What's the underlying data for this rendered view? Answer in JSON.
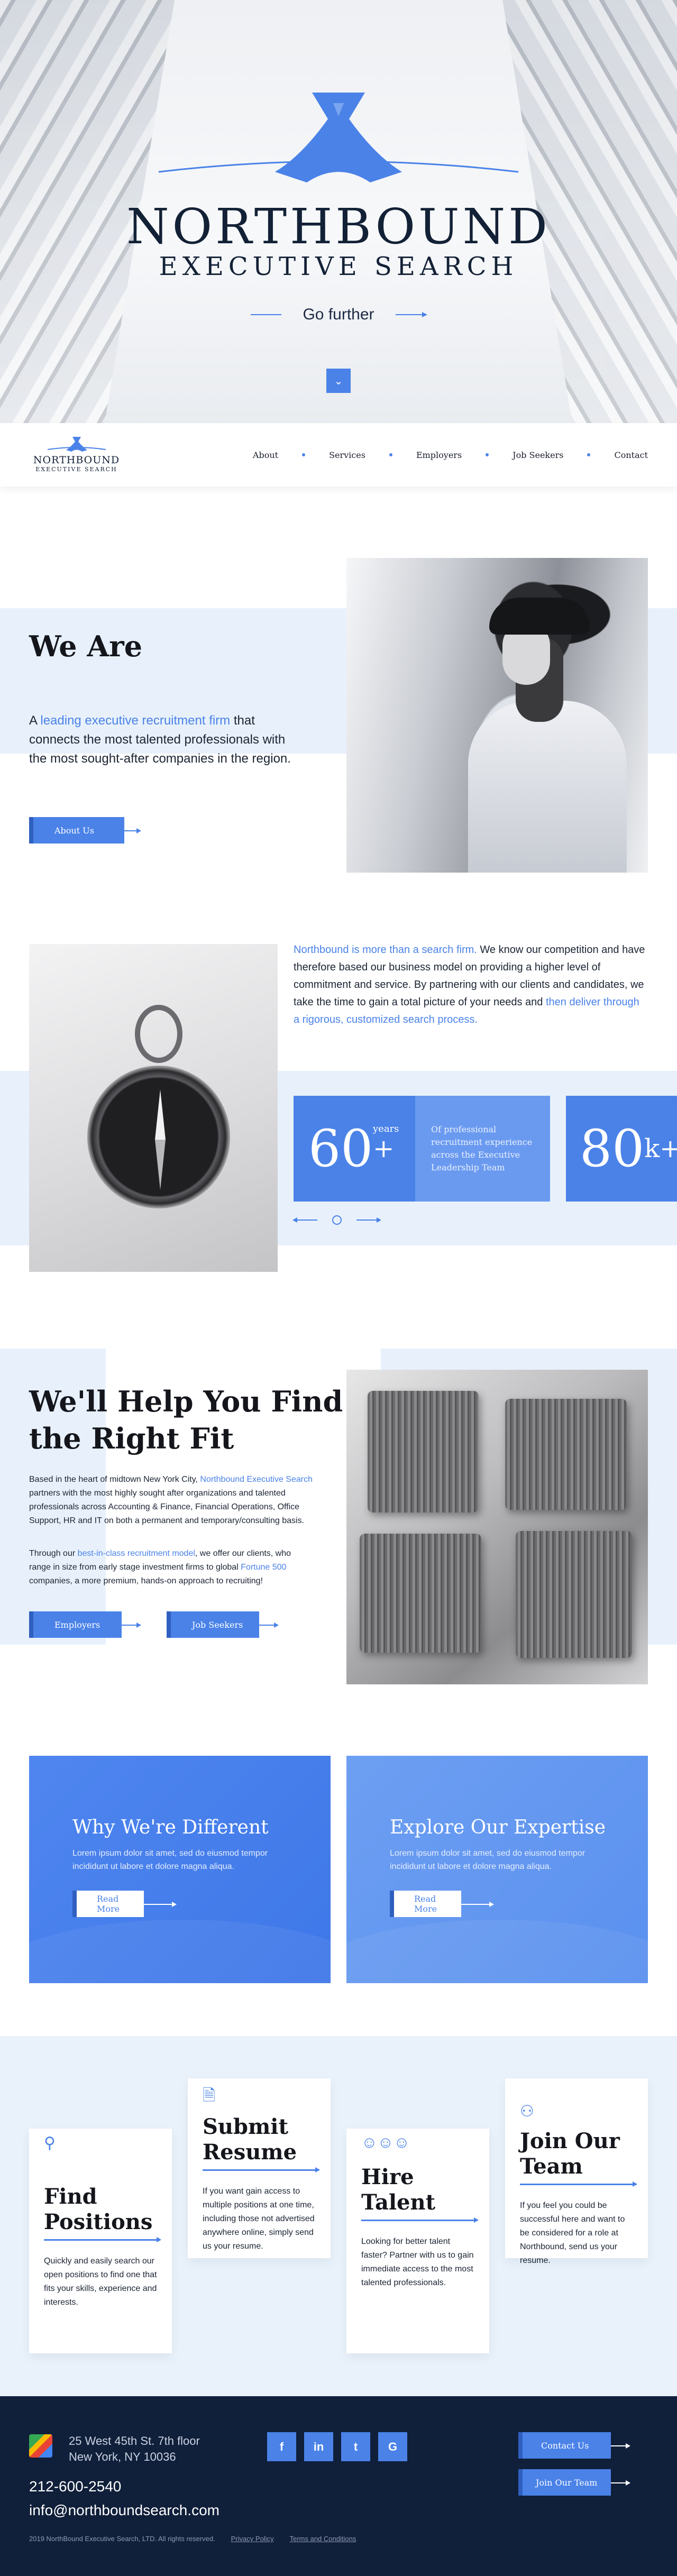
{
  "hero": {
    "brand": "NORTHBOUND",
    "subtitle": "EXECUTIVE SEARCH",
    "tagline": "Go further",
    "scroll_icon": "chevron-down-icon"
  },
  "nav": {
    "logo_brand": "NORTHBOUND",
    "logo_sub": "EXECUTIVE SEARCH",
    "items": [
      "About",
      "Services",
      "Employers",
      "Job Seekers",
      "Contact"
    ]
  },
  "we_are": {
    "title": "We Are",
    "text_pre": "A ",
    "text_link": "leading executive recruitment firm",
    "text_post": " that connects the most talented professionals with the most sought-after companies in the region.",
    "button": "About Us"
  },
  "about": {
    "p_link1": "Northbound",
    "p_blue1": " is more than a search firm.",
    "p_text1": " We know our competition and have therefore based our business model on providing a higher level of commitment and service. By partnering with our clients and candidates, we take the time to gain a total picture of your needs and ",
    "p_link2": "then deliver through a rigorous, customized search process.",
    "stat1_num": "60",
    "stat1_sup": "+",
    "stat1_unit": "years",
    "stat2_text": "Of professional recruitment experience across the Executive Leadership Team",
    "stat3_num": "80",
    "stat3_sup": "k+"
  },
  "help": {
    "title": "We'll Help You Find the Right Fit",
    "p1_pre": "Based in the heart of midtown New York City, ",
    "p1_link": "Northbound Executive Search",
    "p1_post": " partners with the most highly sought after organizations and talented professionals across Accounting & Finance, Financial Operations, Office Support, HR and IT on both a permanent and temporary/consulting basis.",
    "p2_pre": "Through our ",
    "p2_link": "best-in-class recruitment model",
    "p2_mid": ", we offer our clients, who range in size from early stage investment firms to global ",
    "p2_link2": "Fortune 500",
    "p2_post": " companies, a more premium, hands-on approach to recruiting!",
    "button_employers": "Employers",
    "button_seekers": "Job Seekers"
  },
  "cards": [
    {
      "title": "Why We're Different",
      "text": "Lorem ipsum dolor sit amet, sed do eiusmod tempor incididunt ut labore et dolore magna aliqua.",
      "button": "Read More"
    },
    {
      "title": "Explore Our Expertise",
      "text": "Lorem ipsum dolor sit amet, sed do eiusmod tempor incididunt ut labore et dolore magna aliqua.",
      "button": "Read More"
    }
  ],
  "steps": [
    {
      "title": "Find Positions",
      "icon": "search-icon",
      "text": "Quickly and easily search our open positions to find one that fits your skills, experience and interests."
    },
    {
      "title": "Submit Resume",
      "icon": "document-icon",
      "text": "If you want gain access to multiple positions at one time, including those not advertised anywhere online, simply send us your resume."
    },
    {
      "title": "Hire Talent",
      "icon": "team-icon",
      "text": "Looking for better talent faster? Partner with us to gain immediate access to the most talented professionals."
    },
    {
      "title": "Join Our Team",
      "icon": "people-icon",
      "text": "If you feel you could be successful here and want to be considered for a role at Northbound, send us your resume."
    }
  ],
  "footer": {
    "address1": "25 West 45th St.  7th floor",
    "address2": "New York, NY 10036",
    "phone": "212-600-2540",
    "email": "info@northboundsearch.com",
    "copyright": "2019 NorthBound Executive Search, LTD. All rights reserved.",
    "privacy": "Privacy Policy",
    "terms": "Terms and Conditions",
    "social": [
      "f",
      "in",
      "t",
      "G"
    ],
    "contact_button": "Contact Us",
    "join_button": "Join Our Team"
  },
  "colors": {
    "accent": "#4a82e8",
    "navy": "#101f3a",
    "light_band": "#e8f1fb"
  }
}
